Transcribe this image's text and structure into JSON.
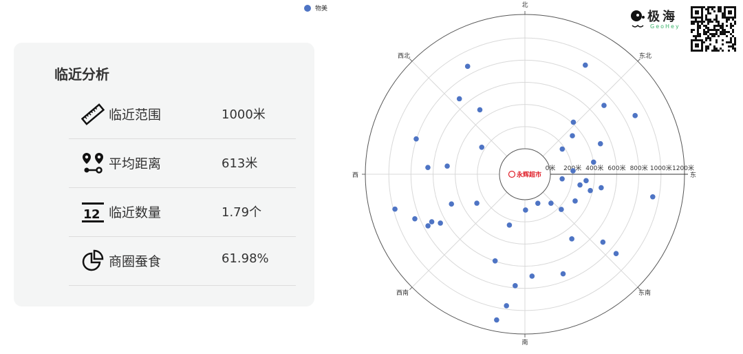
{
  "panel": {
    "title": "临近分析",
    "rows": [
      {
        "icon": "ruler-icon",
        "label": "临近范围",
        "value": "1000米"
      },
      {
        "icon": "route-pins-icon",
        "label": "平均距离",
        "value": "613米"
      },
      {
        "icon": "count-icon",
        "label": "临近数量",
        "value": "1.79个"
      },
      {
        "icon": "pie-chart-icon",
        "label": "商圈蚕食",
        "value": "61.98%"
      }
    ]
  },
  "logo": {
    "name_cn": "极海",
    "name_en": "GeoHey"
  },
  "colors": {
    "point": "#4e74c4",
    "center_label": "#e0202a",
    "panel_bg": "#f4f5f5"
  },
  "chart_data": {
    "type": "scatter",
    "coordinate_system": "polar",
    "center_label": "永辉超市",
    "legend": [
      {
        "name": "物美",
        "position": "top"
      }
    ],
    "radial_axis": {
      "ticks": [
        "0米",
        "200米",
        "400米",
        "600米",
        "800米",
        "1000米",
        "1200米"
      ],
      "range": [
        0,
        1200
      ],
      "unit": "米"
    },
    "angular_axis": {
      "labels": [
        "北",
        "东北",
        "东",
        "东南",
        "南",
        "西南",
        "西",
        "西北"
      ]
    },
    "series": [
      {
        "name": "物美",
        "points_bearing_deg_distance_m": [
          [
            332,
            873
          ],
          [
            29,
            896
          ],
          [
            319,
            673
          ],
          [
            325,
            480
          ],
          [
            49,
            717
          ],
          [
            62,
            898
          ],
          [
            43,
            412
          ],
          [
            51,
            322
          ],
          [
            288,
            803
          ],
          [
            302,
            230
          ],
          [
            56,
            177
          ],
          [
            68,
            506
          ],
          [
            80,
            400
          ],
          [
            274,
            649
          ],
          [
            276,
            476
          ],
          [
            86,
            206
          ],
          [
            97,
            109
          ],
          [
            96,
            326
          ],
          [
            101,
            277
          ],
          [
            100,
            470
          ],
          [
            104,
            379
          ],
          [
            100,
            943
          ],
          [
            248,
            486
          ],
          [
            239,
            277
          ],
          [
            156,
            57
          ],
          [
            138,
            122
          ],
          [
            118,
            284
          ],
          [
            255,
            986
          ],
          [
            179,
            93
          ],
          [
            134,
            227
          ],
          [
            248,
            843
          ],
          [
            243,
            715
          ],
          [
            242,
            762
          ],
          [
            240,
            652
          ],
          [
            197,
            250
          ],
          [
            144,
            491
          ],
          [
            131,
            704
          ],
          [
            131,
            862
          ],
          [
            199,
            597
          ],
          [
            159,
            733
          ],
          [
            176,
            692
          ],
          [
            185,
            780
          ],
          [
            188,
            969
          ],
          [
            191,
            1110
          ]
        ]
      }
    ]
  }
}
